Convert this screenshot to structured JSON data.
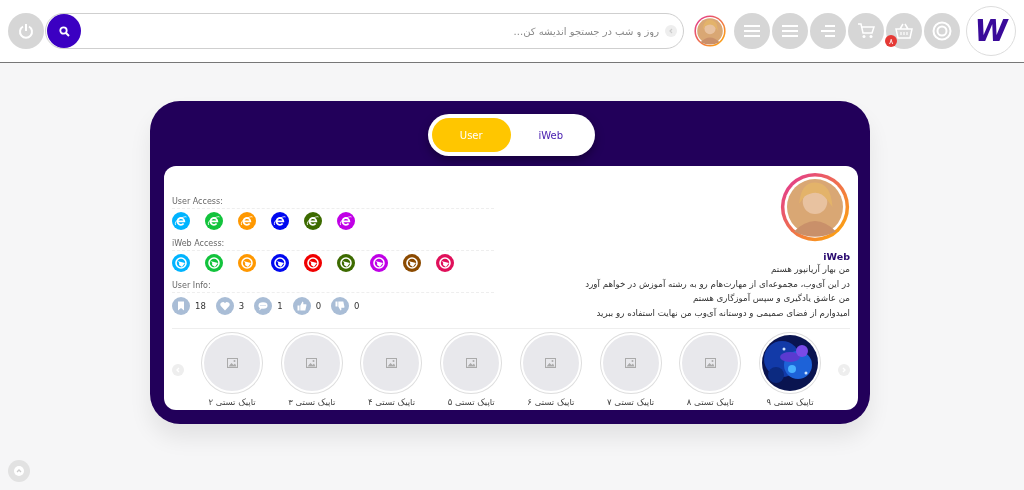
{
  "header": {
    "logo_text": "W",
    "cart_badge": "۸",
    "search": {
      "placeholder": "روز و شب در جستجو اندیشه کن..."
    }
  },
  "toggle": [
    {
      "label": "iWeb",
      "selected": false
    },
    {
      "label": "User",
      "selected": true
    }
  ],
  "profile": {
    "name": "iWeb",
    "bio": [
      "من بهار آریانپور هستم",
      "در این آی‌وب، مجموعه‌ای از مهارت‌هام رو به رشته آموزش در خواهم آورد",
      "من عاشق یادگیری و سپس آموزگاری هستم",
      "امیدوارم از فضای صمیمی و دوستانه آی‌وب من نهایت استفاده رو ببرید"
    ]
  },
  "user_access": {
    "label": "User Access:",
    "icons": [
      {
        "color": "#00b4ff"
      },
      {
        "color": "#12c33c"
      },
      {
        "color": "#ff9800"
      },
      {
        "color": "#0008f0"
      },
      {
        "color": "#3d6b00"
      },
      {
        "color": "#c000e6"
      }
    ]
  },
  "iweb_access": {
    "label": "iWeb Access:",
    "icons": [
      {
        "color": "#00b4ff"
      },
      {
        "color": "#12c33c"
      },
      {
        "color": "#ff9800"
      },
      {
        "color": "#0008f0"
      },
      {
        "color": "#f00000"
      },
      {
        "color": "#3d6b00"
      },
      {
        "color": "#c000e6"
      },
      {
        "color": "#8b4a00"
      },
      {
        "color": "#e0105a"
      }
    ]
  },
  "user_info": {
    "label": "User Info:",
    "stats": [
      {
        "kind": "dislike",
        "count": "0"
      },
      {
        "kind": "like",
        "count": "0"
      },
      {
        "kind": "comment",
        "count": "1"
      },
      {
        "kind": "heart",
        "count": "3"
      },
      {
        "kind": "bookmark",
        "count": "18"
      }
    ]
  },
  "topics": [
    {
      "label": "تاپیک تستی ۹",
      "kind": "picture"
    },
    {
      "label": "تاپیک تستی ۸",
      "kind": "placeholder"
    },
    {
      "label": "تاپیک تستی ۷",
      "kind": "placeholder"
    },
    {
      "label": "تاپیک تستی ۶",
      "kind": "placeholder"
    },
    {
      "label": "تاپیک تستی ۵",
      "kind": "placeholder"
    },
    {
      "label": "تاپیک تستی ۴",
      "kind": "placeholder"
    },
    {
      "label": "تاپیک تستی ۳",
      "kind": "placeholder"
    },
    {
      "label": "تاپیک تستی ۲",
      "kind": "placeholder"
    }
  ]
}
